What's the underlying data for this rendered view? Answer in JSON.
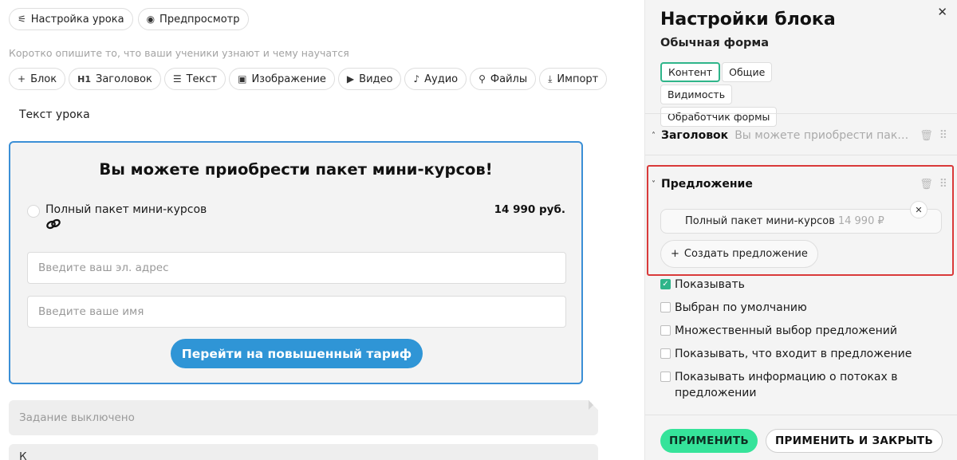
{
  "header": {
    "lesson_settings_label": "Настройка урока",
    "preview_label": "Предпросмотр",
    "description_placeholder": "Коротко опишите то, что ваши ученики узнают и чему научатся"
  },
  "toolbar": {
    "items": [
      {
        "icon": "plus",
        "label": "Блок"
      },
      {
        "icon": "H1",
        "label": "Заголовок"
      },
      {
        "icon": "text-lines",
        "label": "Текст"
      },
      {
        "icon": "image",
        "label": "Изображение"
      },
      {
        "icon": "video",
        "label": "Видео"
      },
      {
        "icon": "music-note",
        "label": "Аудио"
      },
      {
        "icon": "paperclip",
        "label": "Файлы"
      },
      {
        "icon": "download",
        "label": "Импорт"
      }
    ]
  },
  "lesson": {
    "text_label": "Текст урока",
    "task_disabled": "Задание выключено",
    "next_block_text": "К"
  },
  "form_block": {
    "title": "Вы можете приобрести пакет мини-курсов!",
    "offer_name": "Полный пакет мини-курсов",
    "offer_price": "14 990 руб.",
    "email_placeholder": "Введите ваш эл. адрес",
    "name_placeholder": "Введите ваше имя",
    "submit_label": "Перейти на повышенный тариф"
  },
  "panel": {
    "title": "Настройки блока",
    "subtitle": "Обычная форма",
    "tabs": [
      "Контент",
      "Общие",
      "Видимость",
      "Обработчик формы"
    ],
    "active_tab": "Контент",
    "sections": {
      "heading": {
        "title": "Заголовок",
        "preview": "Вы можете приобрести пакет м..."
      },
      "offer": {
        "title": "Предложение"
      }
    },
    "offer_item": {
      "name": "Полный пакет мини-курсов",
      "price": "14 990 ₽"
    },
    "create_offer_label": "Создать предложение",
    "checkboxes": [
      {
        "label": "Показывать",
        "checked": true
      },
      {
        "label": "Выбран по умолчанию",
        "checked": false
      },
      {
        "label": "Множественный выбор предложений",
        "checked": false
      },
      {
        "label": "Показывать, что входит в предложение",
        "checked": false
      },
      {
        "label": "Показывать информацию о потоках в предложении",
        "checked": false
      }
    ],
    "apply_label": "ПРИМЕНИТЬ",
    "apply_close_label": "ПРИМЕНИТЬ И ЗАКРЫТЬ"
  },
  "colors": {
    "accent_green": "#35e39a",
    "tab_active_border": "#2fb58a",
    "form_border_blue": "#3b8fd6",
    "submit_blue": "#2f95d6",
    "highlight_red": "#d93a3a"
  }
}
